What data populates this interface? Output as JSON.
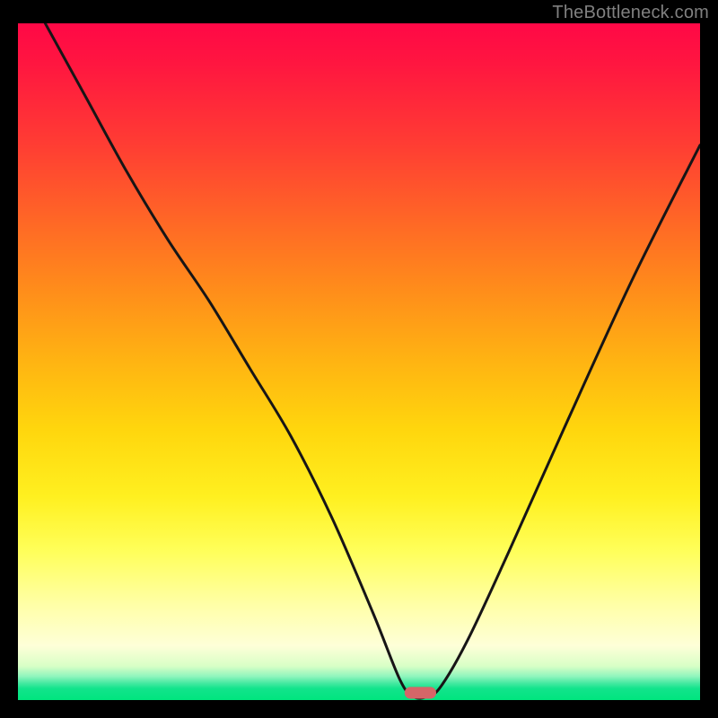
{
  "watermark": "TheBottleneck.com",
  "chart_data": {
    "type": "line",
    "title": "",
    "xlabel": "",
    "ylabel": "",
    "xlim": [
      0,
      100
    ],
    "ylim": [
      0,
      100
    ],
    "grid": false,
    "legend": false,
    "background_gradient": {
      "direction": "vertical",
      "stops": [
        {
          "pos": 0,
          "color": "#ff0846"
        },
        {
          "pos": 18,
          "color": "#ff3d33"
        },
        {
          "pos": 40,
          "color": "#ff8f1a"
        },
        {
          "pos": 60,
          "color": "#ffd60d"
        },
        {
          "pos": 78,
          "color": "#ffff5a"
        },
        {
          "pos": 92,
          "color": "#feffd8"
        },
        {
          "pos": 97,
          "color": "#46e9a1"
        },
        {
          "pos": 100,
          "color": "#00e57e"
        }
      ]
    },
    "series": [
      {
        "name": "bottleneck-curve",
        "comment": "V-shaped curve; x is relative horizontal position (0–100), y is bottleneck % (100=top, 0=bottom). Values estimated from pixel positions.",
        "x": [
          4,
          10,
          16,
          22,
          28,
          34,
          40,
          46,
          52,
          56,
          58,
          60,
          62,
          66,
          72,
          80,
          90,
          100
        ],
        "y": [
          100,
          89,
          78,
          68,
          59,
          49,
          39,
          27,
          13,
          3,
          0.5,
          0.5,
          2,
          9,
          22,
          40,
          62,
          82
        ]
      }
    ],
    "annotations": [
      {
        "name": "bottleneck-marker",
        "shape": "capsule",
        "x": 59,
        "y": 0,
        "width_pct": 4.5,
        "height_pct": 1.6,
        "color": "#d56668"
      }
    ]
  }
}
